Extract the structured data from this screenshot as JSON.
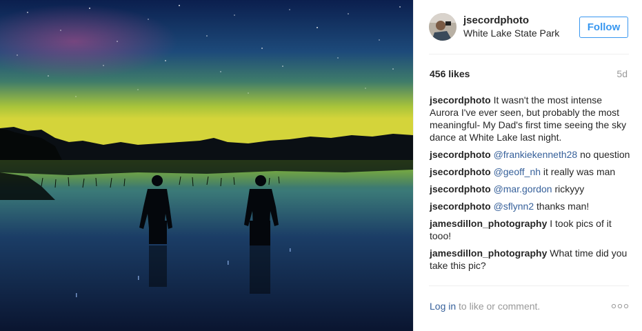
{
  "post": {
    "photo_icon": "aurora-landscape-photo"
  },
  "header": {
    "username": "jsecordphoto",
    "location": "White Lake State Park",
    "follow_label": "Follow"
  },
  "stats": {
    "likes": "456 likes",
    "age": "5d"
  },
  "comments": [
    {
      "user": "jsecordphoto",
      "mention": "",
      "text": "It wasn't the most intense Aurora I've ever seen, but probably the most meaningful- My Dad's first time seeing the sky dance at White Lake last night."
    },
    {
      "user": "jsecordphoto",
      "mention": "@frankiekenneth28",
      "text": "no question"
    },
    {
      "user": "jsecordphoto",
      "mention": "@geoff_nh",
      "text": "it really was man"
    },
    {
      "user": "jsecordphoto",
      "mention": "@mar.gordon",
      "text": "rickyyy"
    },
    {
      "user": "jsecordphoto",
      "mention": "@sflynn2",
      "text": "thanks man!"
    },
    {
      "user": "jamesdillon_photography",
      "mention": "",
      "text": "I took pics of it tooo!"
    },
    {
      "user": "jamesdillon_photography",
      "mention": "",
      "text": "What time did you take this pic?"
    }
  ],
  "footer": {
    "login_label": "Log in",
    "prompt": "to like or comment.",
    "more_icon": "more-options-icon"
  },
  "colors": {
    "accent": "#3897f0",
    "link": "#36609a",
    "muted": "#999999",
    "text": "#262626"
  }
}
